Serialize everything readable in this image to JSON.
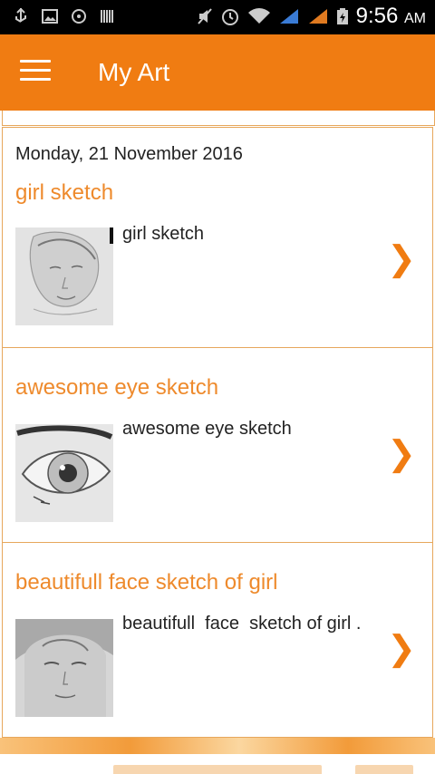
{
  "status": {
    "time": "9:56",
    "ampm": "AM"
  },
  "appbar": {
    "title": "My Art"
  },
  "colors": {
    "accent": "#f07c12",
    "heading": "#ee8a2c",
    "border": "#e7a75c"
  },
  "items": [
    {
      "date": "Monday, 21 November 2016",
      "title": "girl sketch",
      "description": "girl sketch",
      "thumb_icon": "girl-sketch-thumbnail"
    },
    {
      "title": "awesome eye sketch",
      "description": "awesome eye sketch",
      "thumb_icon": "eye-sketch-thumbnail"
    },
    {
      "title": "beautifull face sketch of girl",
      "description": "beautifull  face  sketch of girl .",
      "thumb_icon": "face-sketch-thumbnail"
    }
  ],
  "chevron": "❯"
}
